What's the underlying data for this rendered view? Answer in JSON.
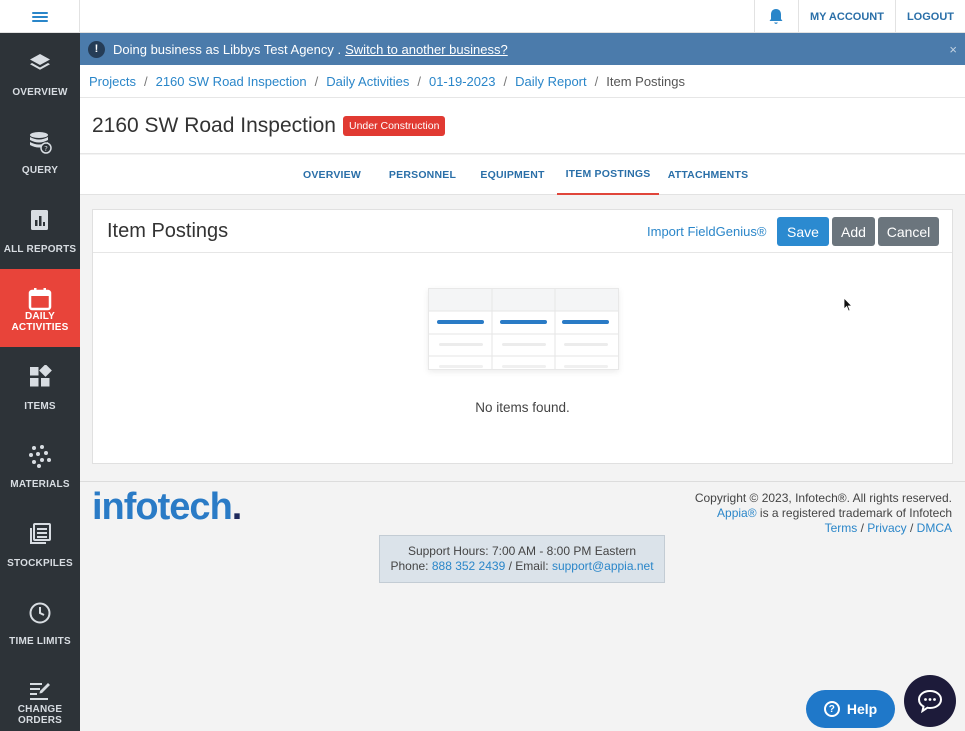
{
  "topbar": {
    "my_account": "MY ACCOUNT",
    "logout": "LOGOUT"
  },
  "sidebar": {
    "items": [
      {
        "label": "OVERVIEW",
        "icon": "layers-icon"
      },
      {
        "label": "QUERY",
        "icon": "database-query-icon"
      },
      {
        "label": "ALL REPORTS",
        "icon": "report-chart-icon"
      },
      {
        "label": "DAILY ACTIVITIES",
        "icon": "calendar-icon",
        "active": true
      },
      {
        "label": "ITEMS",
        "icon": "grid-icon"
      },
      {
        "label": "MATERIALS",
        "icon": "dots-icon"
      },
      {
        "label": "STOCKPILES",
        "icon": "stack-icon"
      },
      {
        "label": "TIME LIMITS",
        "icon": "clock-icon"
      },
      {
        "label": "CHANGE ORDERS",
        "icon": "edit-list-icon"
      }
    ]
  },
  "banner": {
    "text": "Doing business as Libbys Test Agency .",
    "link": "Switch to another business?",
    "close": "×"
  },
  "breadcrumb": {
    "items": [
      "Projects",
      "2160 SW Road Inspection",
      "Daily Activities",
      "01-19-2023",
      "Daily Report"
    ],
    "current": "Item Postings",
    "separator": "/"
  },
  "page": {
    "title": "2160 SW Road Inspection",
    "status_badge": "Under Construction"
  },
  "tabs": {
    "items": [
      "OVERVIEW",
      "PERSONNEL",
      "EQUIPMENT",
      "ITEM POSTINGS",
      "ATTACHMENTS"
    ],
    "active": "ITEM POSTINGS"
  },
  "panel": {
    "title": "Item Postings",
    "import_link": "Import FieldGenius®",
    "save": "Save",
    "add": "Add",
    "cancel": "Cancel",
    "empty_text": "No items found."
  },
  "footer": {
    "logo_main": "info",
    "logo_accent": "tech",
    "copyright": "Copyright © 2023, Infotech®. All rights reserved.",
    "trademark_link": "Appia®",
    "trademark_text": " is a registered trademark of Infotech",
    "terms": "Terms",
    "privacy": "Privacy",
    "dmca": "DMCA",
    "link_sep": " / ",
    "support_hours": "Support Hours: 7:00 AM - 8:00 PM Eastern",
    "phone_label": "Phone: ",
    "phone": "888 352 2439",
    "email_label": " / Email: ",
    "email": "support@appia.net"
  },
  "widgets": {
    "help": "Help",
    "help_icon_glyph": "?"
  },
  "colors": {
    "sidebar_bg": "#2d3338",
    "sidebar_active": "#e8443a",
    "banner_bg": "#4b7bab",
    "link_blue": "#2a86c9",
    "save_blue": "#2b8ad0",
    "gray_button": "#6b757d",
    "badge_red": "#e13a32"
  }
}
